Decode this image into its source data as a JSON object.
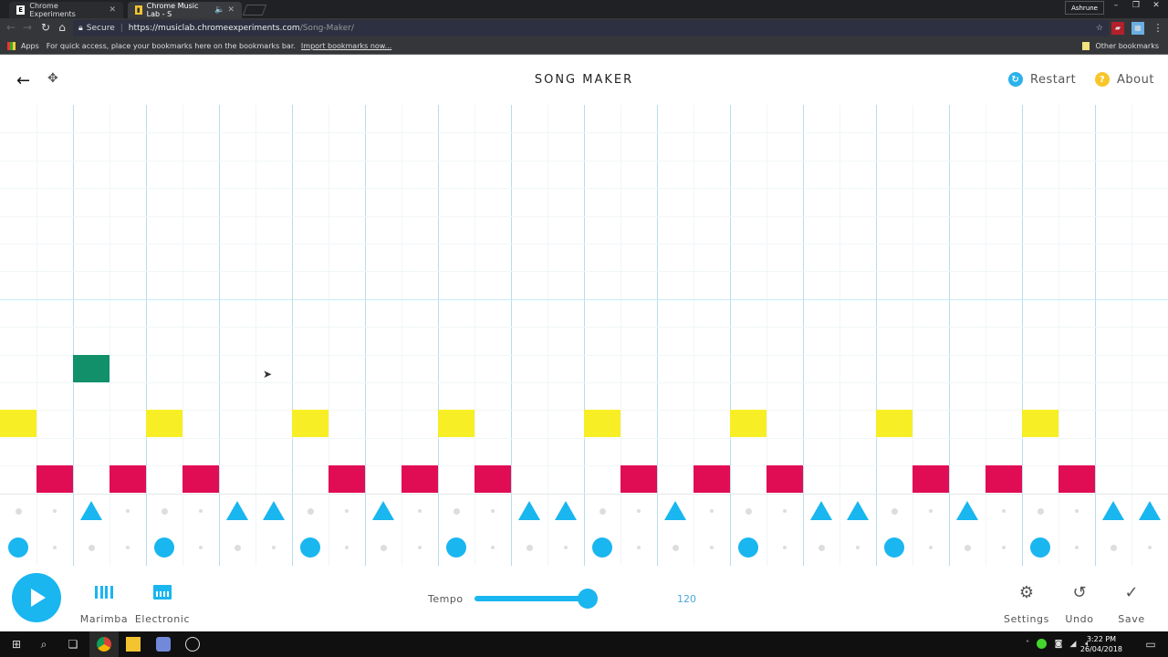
{
  "browser": {
    "tabs": [
      {
        "label": "Chrome Experiments",
        "favicon": "E",
        "active": false
      },
      {
        "label": "Chrome Music Lab - S",
        "favicon": "music-lab-icon",
        "active": true,
        "audio": true
      }
    ],
    "profile": "Ashrune",
    "address": {
      "secure_label": "Secure",
      "url_host": "https://musiclab.chromeexperiments.com",
      "url_path": "/Song-Maker/"
    },
    "bookmarks": {
      "apps_label": "Apps",
      "hint": "For quick access, place your bookmarks here on the bookmarks bar.",
      "import_link": "Import bookmarks now...",
      "other_label": "Other bookmarks"
    }
  },
  "header": {
    "title": "SONG MAKER",
    "restart_label": "Restart",
    "about_label": "About"
  },
  "colors": {
    "accent": "#19b6f0",
    "note_red": "#e00d54",
    "note_yellow": "#f8ee25",
    "note_green": "#11906a",
    "restart_icon": "#2ab3ea",
    "about_icon": "#f8c62a"
  },
  "song": {
    "columns": 32,
    "melody_rows": 14,
    "notes": [
      {
        "row": 13,
        "col": 1,
        "color": "red"
      },
      {
        "row": 13,
        "col": 3,
        "color": "red"
      },
      {
        "row": 13,
        "col": 5,
        "color": "red"
      },
      {
        "row": 13,
        "col": 9,
        "color": "red"
      },
      {
        "row": 13,
        "col": 11,
        "color": "red"
      },
      {
        "row": 13,
        "col": 13,
        "color": "red"
      },
      {
        "row": 13,
        "col": 17,
        "color": "red"
      },
      {
        "row": 13,
        "col": 19,
        "color": "red"
      },
      {
        "row": 13,
        "col": 21,
        "color": "red"
      },
      {
        "row": 13,
        "col": 25,
        "color": "red"
      },
      {
        "row": 13,
        "col": 27,
        "color": "red"
      },
      {
        "row": 13,
        "col": 29,
        "color": "red"
      },
      {
        "row": 11,
        "col": 0,
        "color": "yellow"
      },
      {
        "row": 11,
        "col": 4,
        "color": "yellow"
      },
      {
        "row": 11,
        "col": 8,
        "color": "yellow"
      },
      {
        "row": 11,
        "col": 12,
        "color": "yellow"
      },
      {
        "row": 11,
        "col": 16,
        "color": "yellow"
      },
      {
        "row": 11,
        "col": 20,
        "color": "yellow"
      },
      {
        "row": 11,
        "col": 24,
        "color": "yellow"
      },
      {
        "row": 11,
        "col": 28,
        "color": "yellow"
      },
      {
        "row": 9,
        "col": 2,
        "color": "green"
      }
    ],
    "percussion_triangles": [
      2,
      6,
      7,
      10,
      14,
      15,
      18,
      22,
      23,
      26,
      30,
      31
    ],
    "percussion_circles": [
      0,
      4,
      8,
      12,
      16,
      20,
      24,
      28
    ]
  },
  "controls": {
    "instruments": [
      {
        "label": "Marimba",
        "icon": "marimba-icon"
      },
      {
        "label": "Electronic",
        "icon": "electronic-drum-icon"
      }
    ],
    "tempo_label": "Tempo",
    "tempo_value": "120",
    "tempo_fraction": 0.9,
    "settings_label": "Settings",
    "undo_label": "Undo",
    "save_label": "Save"
  },
  "taskbar": {
    "time": "3:22 PM",
    "date": "26/04/2018"
  }
}
